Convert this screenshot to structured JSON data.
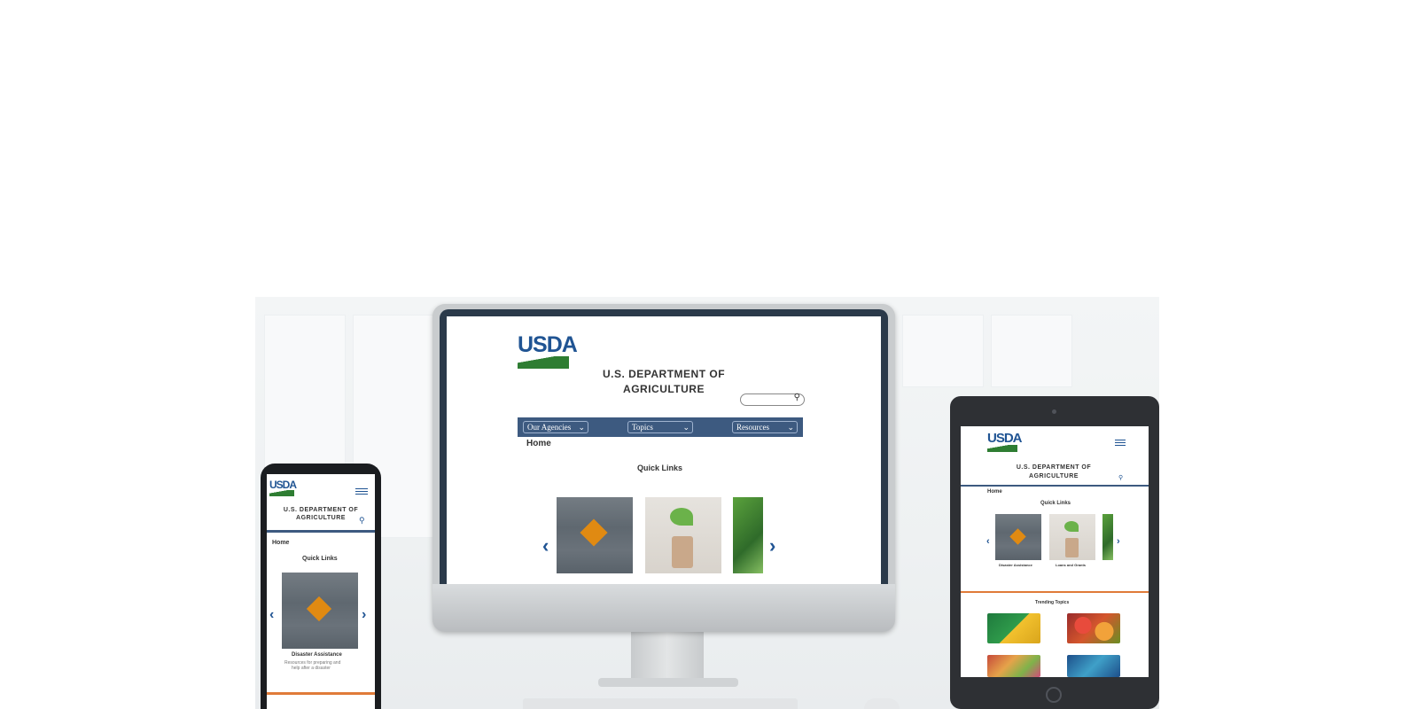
{
  "desktop": {
    "logo": "USDA",
    "title_line1": "U.S. DEPARTMENT OF",
    "title_line2": "AGRICULTURE",
    "nav": [
      "Our Agencies",
      "Topics",
      "Resources"
    ],
    "breadcrumb": "Home",
    "section": "Quick Links",
    "prev": "‹",
    "next": "›"
  },
  "phone": {
    "logo": "USDA",
    "title_line1": "U.S. DEPARTMENT OF",
    "title_line2": "AGRICULTURE",
    "breadcrumb": "Home",
    "section": "Quick Links",
    "card_title": "Disaster Assistance",
    "card_desc_line1": "Resources for preparing and",
    "card_desc_line2": "help after a disaster",
    "prev": "‹",
    "next": "›"
  },
  "tablet": {
    "logo": "USDA",
    "title_line1": "U.S. DEPARTMENT OF",
    "title_line2": "AGRICULTURE",
    "breadcrumb": "Home",
    "section": "Quick Links",
    "card1_title": "Disaster Assistance",
    "card2_title": "Loans and Grants",
    "trending": "Trending Topics",
    "prev": "‹",
    "next": "›"
  },
  "colors": {
    "usda_blue": "#205493",
    "usda_green": "#2e7d32",
    "nav_blue": "#3d5a80",
    "accent_orange": "#e07b39"
  }
}
